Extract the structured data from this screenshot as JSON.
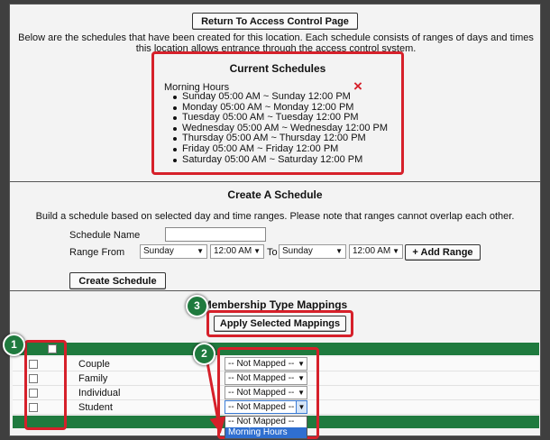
{
  "top": {
    "return_button": "Return To Access Control Page",
    "intro_line1": "Below are the schedules that have been created for this location. Each schedule consists of ranges of days and times",
    "intro_line2": "this location allows entrance through the access control system.",
    "current_title": "Current Schedules",
    "schedule_name": "Morning Hours",
    "delete_icon": "×",
    "ranges": [
      "Sunday 05:00 AM ~ Sunday 12:00 PM",
      "Monday 05:00 AM ~ Monday 12:00 PM",
      "Tuesday 05:00 AM ~ Tuesday 12:00 PM",
      "Wednesday 05:00 AM ~ Wednesday 12:00 PM",
      "Thursday 05:00 AM ~ Thursday 12:00 PM",
      "Friday 05:00 AM ~ Friday 12:00 PM",
      "Saturday 05:00 AM ~ Saturday 12:00 PM"
    ]
  },
  "create": {
    "title": "Create A Schedule",
    "description": "Build a schedule based on selected day and time ranges. Please note that ranges cannot overlap each other.",
    "schedule_name_label": "Schedule Name",
    "schedule_name_value": "",
    "range_from_label": "Range From",
    "from_day": "Sunday",
    "from_time": "12:00 AM",
    "to_label": "To",
    "to_day": "Sunday",
    "to_time": "12:00 AM",
    "add_range_button": "+ Add Range",
    "create_button": "Create Schedule"
  },
  "mappings": {
    "title": "Membership Type Mappings",
    "apply_button": "Apply Selected Mappings",
    "rows": [
      {
        "label": "Couple",
        "mapping": "-- Not Mapped --"
      },
      {
        "label": "Family",
        "mapping": "-- Not Mapped --"
      },
      {
        "label": "Individual",
        "mapping": "-- Not Mapped --"
      },
      {
        "label": "Student",
        "mapping": "-- Not Mapped --"
      }
    ],
    "dropdown_options": [
      "-- Not Mapped --",
      "Morning Hours"
    ]
  },
  "callouts": [
    "1",
    "2",
    "3"
  ],
  "colors": {
    "header_green": "#1f7a3e",
    "highlight_red": "#d6202a",
    "selected_blue": "#2f6fd0"
  }
}
